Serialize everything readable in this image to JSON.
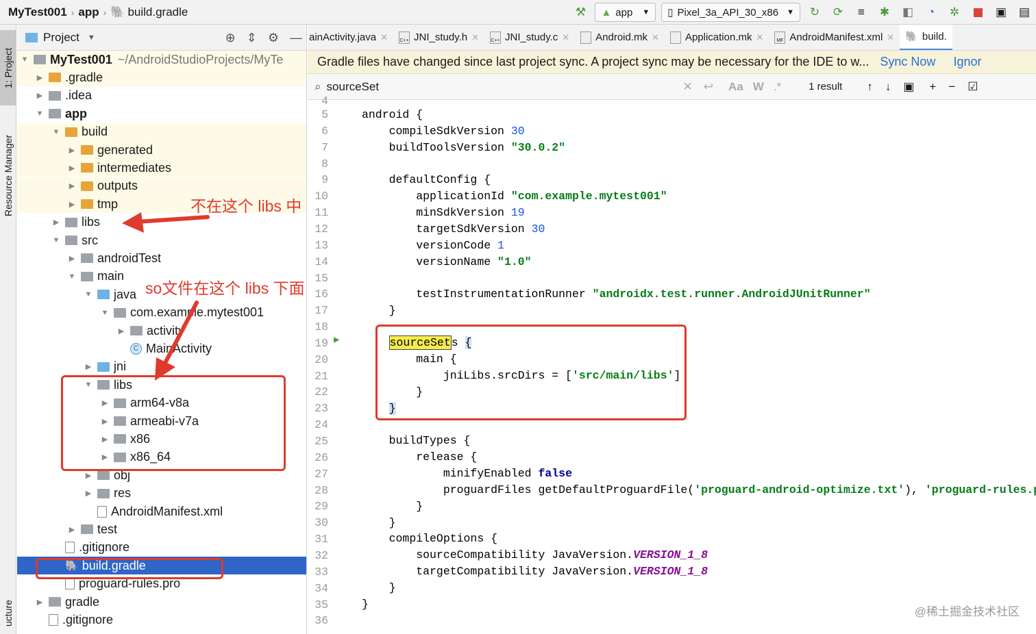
{
  "breadcrumb": {
    "project": "MyTest001",
    "module": "app",
    "file": "build.gradle"
  },
  "toolbar": {
    "run_config": "app",
    "device": "Pixel_3a_API_30_x86"
  },
  "left_strip": {
    "project_tab": "1: Project",
    "resource_tab": "Resource Manager",
    "structure_tab": "ucture"
  },
  "project_panel": {
    "title": "Project",
    "root_path": "~/AndroidStudioProjects/MyTe",
    "items": [
      {
        "label": "MyTest001"
      },
      {
        "label": ".gradle"
      },
      {
        "label": ".idea"
      },
      {
        "label": "app"
      },
      {
        "label": "build"
      },
      {
        "label": "generated"
      },
      {
        "label": "intermediates"
      },
      {
        "label": "outputs"
      },
      {
        "label": "tmp"
      },
      {
        "label": "libs"
      },
      {
        "label": "src"
      },
      {
        "label": "androidTest"
      },
      {
        "label": "main"
      },
      {
        "label": "java"
      },
      {
        "label": "com.example.mytest001"
      },
      {
        "label": "activity"
      },
      {
        "label": "MainActivity"
      },
      {
        "label": "jni"
      },
      {
        "label": "libs"
      },
      {
        "label": "arm64-v8a"
      },
      {
        "label": "armeabi-v7a"
      },
      {
        "label": "x86"
      },
      {
        "label": "x86_64"
      },
      {
        "label": "obj"
      },
      {
        "label": "res"
      },
      {
        "label": "AndroidManifest.xml"
      },
      {
        "label": "test"
      },
      {
        "label": ".gitignore"
      },
      {
        "label": "build.gradle"
      },
      {
        "label": "proguard-rules.pro"
      },
      {
        "label": "gradle"
      },
      {
        "label": ".gitignore"
      }
    ]
  },
  "tabs": [
    {
      "label": "ainActivity.java"
    },
    {
      "label": "JNI_study.h"
    },
    {
      "label": "JNI_study.c"
    },
    {
      "label": "Android.mk"
    },
    {
      "label": "Application.mk"
    },
    {
      "label": "AndroidManifest.xml"
    },
    {
      "label": "build."
    }
  ],
  "sync_banner": {
    "message": "Gradle files have changed since last project sync. A project sync may be necessary for the IDE to w...",
    "sync_now": "Sync Now",
    "ignore": "Ignor"
  },
  "find": {
    "query": "sourceSet",
    "result_count": "1 result",
    "match_case": "Aa",
    "words": "W",
    "regex": ".*"
  },
  "code": {
    "line_numbers": [
      "4",
      "5",
      "6",
      "7",
      "8",
      "9",
      "10",
      "11",
      "12",
      "13",
      "14",
      "15",
      "16",
      "17",
      "18",
      "19",
      "20",
      "21",
      "22",
      "23",
      "24",
      "25",
      "26",
      "27",
      "28",
      "29",
      "30",
      "31",
      "32",
      "33",
      "34",
      "35",
      "36"
    ],
    "l5_kw": "android {",
    "l6": "compileSdkVersion",
    "l6_num": "30",
    "l7": "buildToolsVersion",
    "l7_str": "\"30.0.2\"",
    "l9": "defaultConfig {",
    "l10": "applicationId",
    "l10_str": "\"com.example.mytest001\"",
    "l11": "minSdkVersion",
    "l11_num": "19",
    "l12": "targetSdkVersion",
    "l12_num": "30",
    "l13": "versionCode",
    "l13_num": "1",
    "l14": "versionName",
    "l14_str": "\"1.0\"",
    "l16": "testInstrumentationRunner",
    "l16_str": "\"androidx.test.runner.AndroidJUnitRunner\"",
    "l17": "}",
    "l19_hl": "sourceSet",
    "l19_rest": "s",
    "l19_brace": "{",
    "l20": "main {",
    "l21": "jniLibs.srcDirs = [",
    "l21_str": "'src/main/libs'",
    "l21_end": "]",
    "l22": "}",
    "l23": "}",
    "l25": "buildTypes {",
    "l26": "release {",
    "l27": "minifyEnabled",
    "l27_kw": "false",
    "l28": "proguardFiles getDefaultProguardFile(",
    "l28_str1": "'proguard-android-optimize.txt'",
    "l28_mid": "),",
    "l28_str2": "'proguard-rules.pro'",
    "l29": "}",
    "l30": "}",
    "l31": "compileOptions {",
    "l32": "sourceCompatibility JavaVersion.",
    "l32_cst": "VERSION_1_8",
    "l33": "targetCompatibility JavaVersion.",
    "l33_cst": "VERSION_1_8",
    "l34": "}",
    "l35": "}"
  },
  "annotations": {
    "not_here": "不在这个 libs 中",
    "so_here": "so文件在这个 libs 下面"
  },
  "watermark": "@稀土掘金技术社区",
  "colors": {
    "annotation_red": "#e03a2c",
    "selection_blue": "#2e65c7",
    "link_blue": "#2a6fd0"
  }
}
